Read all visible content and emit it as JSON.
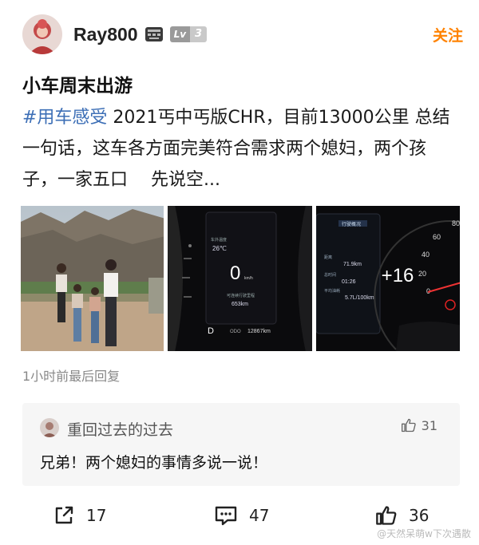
{
  "post": {
    "username": "Ray800",
    "level_prefix": "Lv",
    "level": "3",
    "follow_label": "关注",
    "title": "小车周末出游",
    "hashtag": "#用车感受",
    "body": " 2021丐中丐版CHR，目前13000公里 总结一句话，这车各方面完美符合需求两个媳妇，两个孩子，一家五口　 先说空...",
    "meta": "1小时前最后回复"
  },
  "images": {
    "dash_speed": "0",
    "dash_unit": "km/h",
    "dash_temp_label": "车外温度",
    "dash_temp": "26℃",
    "dash_range_label": "可连续行驶里程",
    "dash_range": "653km",
    "dash_gear": "D",
    "dash_odo_label": "ODO",
    "dash_odo": "12867km",
    "trip_title": "行驶概况",
    "trip_dist_label": "距离",
    "trip_dist": "71.9km",
    "trip_time_label": "总时间",
    "trip_time": "01:26",
    "trip_fuel_label": "平均油耗",
    "trip_fuel": "5.7L/100km",
    "more_count": "+16",
    "gauge_ticks": [
      "0",
      "20",
      "40",
      "60",
      "80"
    ]
  },
  "comment": {
    "user": "重回过去的过去",
    "likes": "31",
    "text": "兄弟！两个媳妇的事情多说一说！"
  },
  "actions": {
    "share_count": "17",
    "comment_count": "47",
    "like_count": "36"
  },
  "watermark": "@天然呆萌w下次遇散",
  "colors": {
    "follow": "#ff8200",
    "hashtag": "#3d6fb6",
    "comment_bg": "#f6f6f6"
  }
}
